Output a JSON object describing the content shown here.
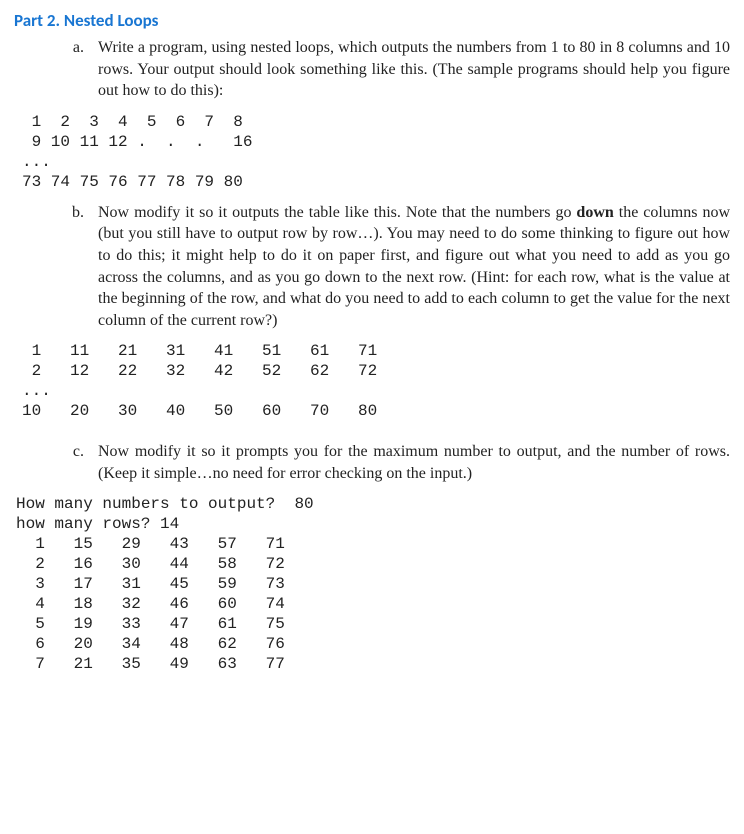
{
  "title": "Part 2.  Nested Loops",
  "a": {
    "label": "a.",
    "text": "Write a program, using nested loops, which outputs the numbers from 1 to 80 in 8 columns and 10 rows.  Your output should look something like this. (The sample programs should help you figure out how to do this):",
    "output": " 1  2  3  4  5  6  7  8\n 9 10 11 12 .  .  .   16\n...\n73 74 75 76 77 78 79 80"
  },
  "b": {
    "label": "b.",
    "text_before": "Now modify it so it  outputs the table like this.  Note that the numbers go ",
    "bold": "down",
    "text_after": " the columns now (but you still have to output row by row…).  You may need to do some thinking to figure out how to do this;  it might help to do it on paper first, and figure out what you need to add as you go across the columns, and as you go down to the next row.  (Hint:  for each row, what is the value at the beginning of the row, and what do you need to add to each column to get the value for the  next column of the current row?)",
    "output": " 1   11   21   31   41   51   61   71\n 2   12   22   32   42   52   62   72\n...\n10   20   30   40   50   60   70   80"
  },
  "c": {
    "label": "c.",
    "text": "Now modify it so it prompts you for the maximum number to output, and the number of rows.   (Keep it simple…no need for error checking on the input.)",
    "output": "How many numbers to output?  80\nhow many rows? 14\n  1   15   29   43   57   71\n  2   16   30   44   58   72\n  3   17   31   45   59   73\n  4   18   32   46   60   74\n  5   19   33   47   61   75\n  6   20   34   48   62   76\n  7   21   35   49   63   77"
  }
}
